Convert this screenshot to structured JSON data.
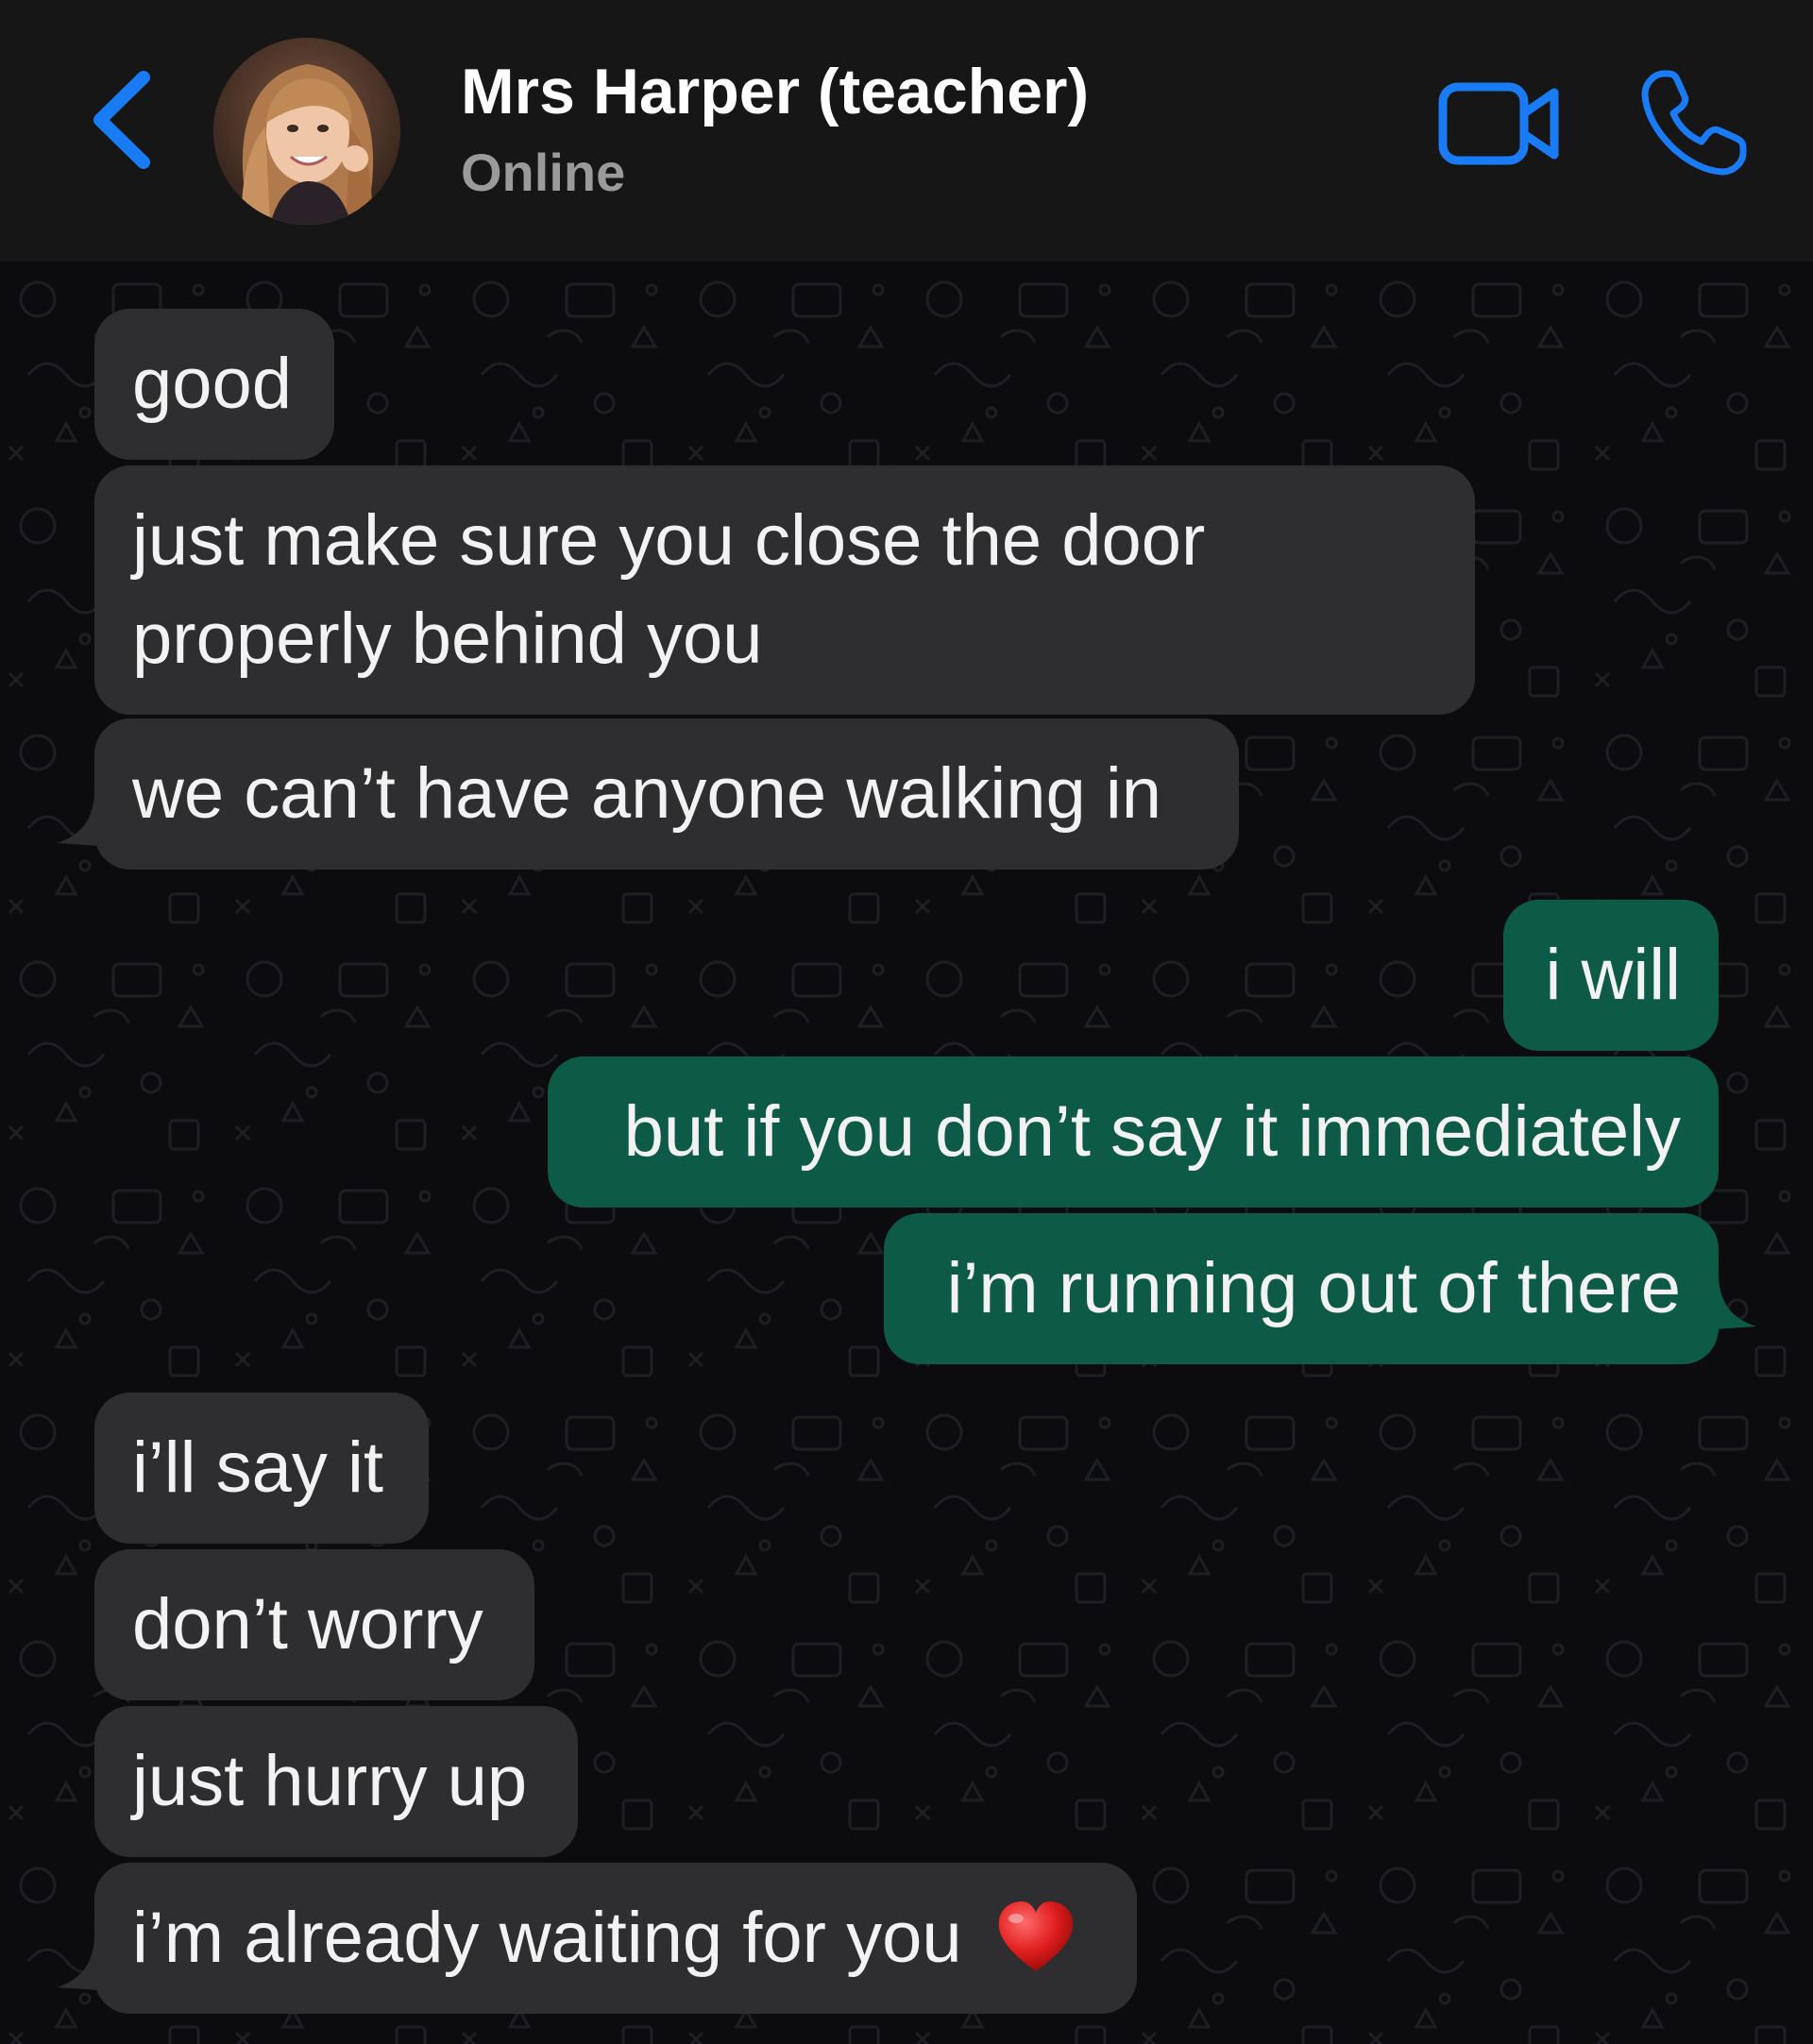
{
  "header": {
    "contact_name": "Mrs Harper (teacher)",
    "status": "Online",
    "icons": {
      "back": "chevron-left-icon",
      "video": "video-camera-icon",
      "call": "phone-icon"
    },
    "accent_color": "#1a7cf5"
  },
  "messages": [
    {
      "direction": "incoming",
      "text": "good"
    },
    {
      "direction": "incoming",
      "text_lines": [
        "just make sure you close the door",
        "properly behind you"
      ]
    },
    {
      "direction": "incoming",
      "text": "we can’t have anyone walking in"
    },
    {
      "direction": "outgoing",
      "text": "i will"
    },
    {
      "direction": "outgoing",
      "text": "but if you don’t say it immediately"
    },
    {
      "direction": "outgoing",
      "text": "i’m running out of there"
    },
    {
      "direction": "incoming",
      "text": "i’ll say it"
    },
    {
      "direction": "incoming",
      "text": "don’t worry"
    },
    {
      "direction": "incoming",
      "text": "just hurry up"
    },
    {
      "direction": "incoming",
      "text": "i’m already waiting for you",
      "emoji": "heart-emoji"
    }
  ],
  "colors": {
    "incoming_bubble": "#2e2e30",
    "outgoing_bubble": "#0d5b47",
    "background": "#0c0c0f",
    "header": "#161616"
  }
}
